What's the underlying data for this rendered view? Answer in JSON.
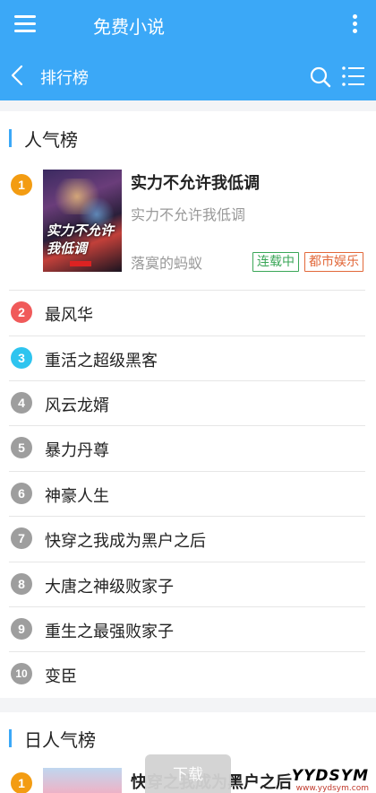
{
  "appbar": {
    "title": "免费小说",
    "menu_icon": "menu-icon",
    "more_icon": "kebab-icon"
  },
  "subbar": {
    "title": "排行榜",
    "back_icon": "chevron-left-icon",
    "search_icon": "search-icon",
    "list_icon": "list-icon"
  },
  "colors": {
    "primary": "#3ba8f7",
    "rank1": "#f39c12",
    "rank2": "#f05a5a",
    "rank3": "#2ec4ef",
    "rank_other": "#9e9e9e",
    "tag_green": "#3aa657",
    "tag_orange": "#e2683a"
  },
  "section1": {
    "title": "人气榜",
    "top": {
      "rank": "1",
      "title": "实力不允许我低调",
      "subtitle": "实力不允许我低调",
      "author": "落寞的蚂蚁",
      "cover_text": "实力不允许我低调",
      "tags": [
        "连载中",
        "都市娱乐"
      ]
    },
    "items": [
      {
        "rank": "2",
        "title": "最风华"
      },
      {
        "rank": "3",
        "title": "重活之超级黑客"
      },
      {
        "rank": "4",
        "title": "风云龙婿"
      },
      {
        "rank": "5",
        "title": "暴力丹尊"
      },
      {
        "rank": "6",
        "title": "神豪人生"
      },
      {
        "rank": "7",
        "title": "快穿之我成为黑户之后"
      },
      {
        "rank": "8",
        "title": "大唐之神级败家子"
      },
      {
        "rank": "9",
        "title": "重生之最强败家子"
      },
      {
        "rank": "10",
        "title": "变臣"
      }
    ]
  },
  "section2": {
    "title": "日人气榜",
    "top": {
      "rank": "1",
      "title": "快穿之我成为黑户之后"
    }
  },
  "download": {
    "label": "下载"
  },
  "watermark": {
    "main": "YYDSYM",
    "url": "www.yydsym.com"
  }
}
